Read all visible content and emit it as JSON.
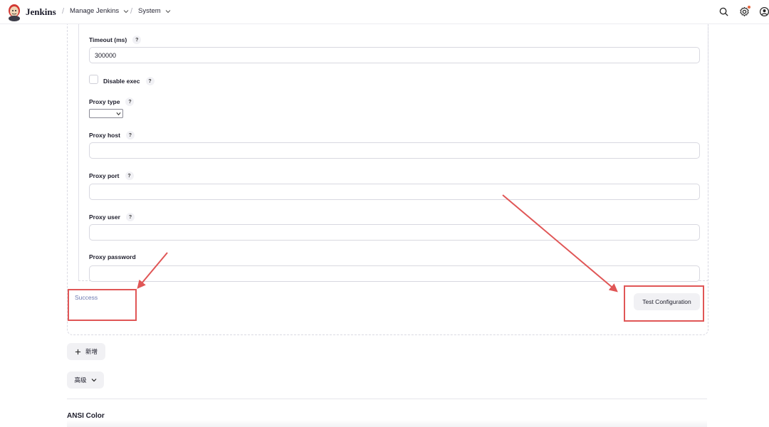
{
  "header": {
    "brand": "Jenkins",
    "breadcrumbs": [
      {
        "label": "Manage Jenkins"
      },
      {
        "label": "System"
      }
    ],
    "icons": [
      "search-icon",
      "gear-icon",
      "user-icon"
    ],
    "notification_color": "#e7663f"
  },
  "form": {
    "timeout_label": "Timeout (ms)",
    "timeout_value": "300000",
    "disable_exec_label": "Disable exec",
    "proxy_type_label": "Proxy type",
    "proxy_type_value": "",
    "proxy_host_label": "Proxy host",
    "proxy_port_label": "Proxy port",
    "proxy_user_label": "Proxy user",
    "proxy_password_label": "Proxy password",
    "help_glyph": "?"
  },
  "result": {
    "status_text": "Success",
    "status_color": "#6e7bb1"
  },
  "actions": {
    "test_configuration": "Test Configuration",
    "add_label": "新增",
    "advanced_label": "高级"
  },
  "section": {
    "title": "ANSI Color"
  },
  "annotation_color": "#e05656"
}
